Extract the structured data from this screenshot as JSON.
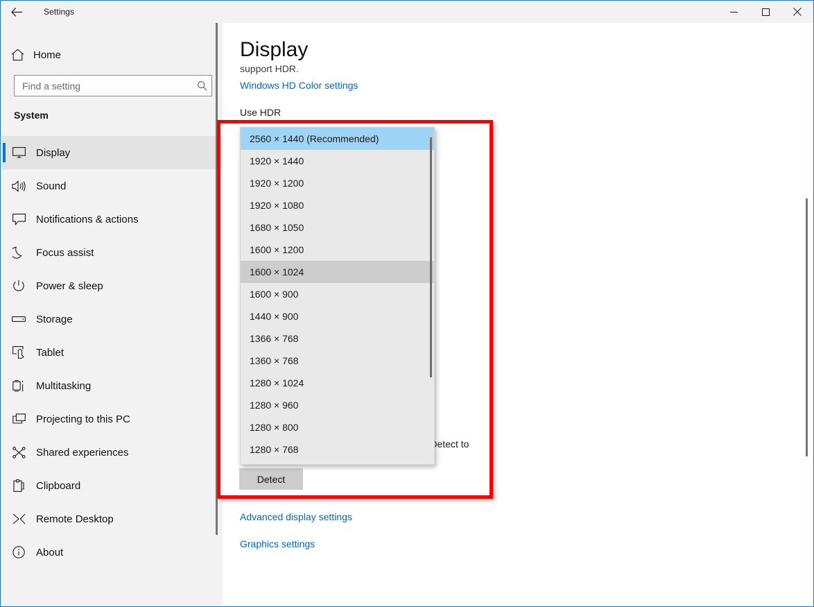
{
  "window": {
    "title": "Settings",
    "back_icon": "back-arrow-icon",
    "minimize_label": "Minimize",
    "maximize_label": "Maximize",
    "close_label": "Close"
  },
  "sidebar": {
    "home_label": "Home",
    "home_icon": "home-icon",
    "search": {
      "placeholder": "Find a setting",
      "value": "",
      "icon": "search-icon"
    },
    "group_label": "System",
    "items": [
      {
        "label": "Display",
        "icon": "monitor-icon",
        "selected": true
      },
      {
        "label": "Sound",
        "icon": "speaker-icon",
        "selected": false
      },
      {
        "label": "Notifications & actions",
        "icon": "chat-bubble-icon",
        "selected": false
      },
      {
        "label": "Focus assist",
        "icon": "moon-icon",
        "selected": false
      },
      {
        "label": "Power & sleep",
        "icon": "power-icon",
        "selected": false
      },
      {
        "label": "Storage",
        "icon": "drive-icon",
        "selected": false
      },
      {
        "label": "Tablet",
        "icon": "tablet-icon",
        "selected": false
      },
      {
        "label": "Multitasking",
        "icon": "multitask-icon",
        "selected": false
      },
      {
        "label": "Projecting to this PC",
        "icon": "project-icon",
        "selected": false
      },
      {
        "label": "Shared experiences",
        "icon": "share-icon",
        "selected": false
      },
      {
        "label": "Clipboard",
        "icon": "clipboard-icon",
        "selected": false
      },
      {
        "label": "Remote Desktop",
        "icon": "remote-desktop-icon",
        "selected": false
      },
      {
        "label": "About",
        "icon": "info-icon",
        "selected": false
      }
    ]
  },
  "main": {
    "page_title": "Display",
    "clipped_text": "support HDR.",
    "hd_color_link": "Windows HD Color settings",
    "use_hdr_label": "Use HDR",
    "detect_description": "Detect another display automatically. Select Detect to",
    "detect_button": "Detect",
    "advanced_link": "Advanced display settings",
    "graphics_link": "Graphics settings"
  },
  "dropdown": {
    "name": "display-resolution-dropdown",
    "options": [
      "2560 × 1440 (Recommended)",
      "1920 × 1440",
      "1920 × 1200",
      "1920 × 1080",
      "1680 × 1050",
      "1600 × 1200",
      "1600 × 1024",
      "1600 × 900",
      "1440 × 900",
      "1366 × 768",
      "1360 × 768",
      "1280 × 1024",
      "1280 × 960",
      "1280 × 800",
      "1280 × 768"
    ],
    "selected_index": 0,
    "hovered_index": 6
  },
  "annotation": {
    "type": "highlight-rectangle",
    "color": "#f70000"
  },
  "colors": {
    "accent": "#0078d7",
    "link": "#0067c0",
    "selection": "#9ed5f7",
    "hover": "#cdcdcd",
    "sidebar_bg": "#f2f2f2",
    "popup_bg": "#e9e9e9"
  }
}
